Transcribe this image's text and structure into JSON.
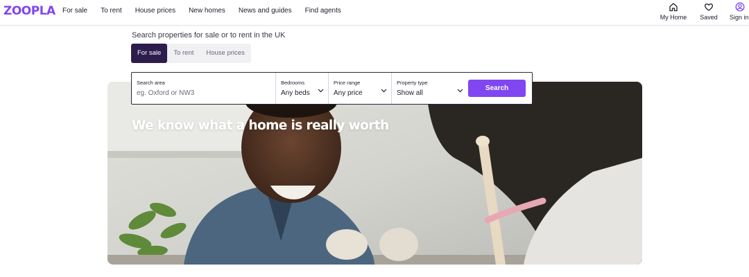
{
  "brand": {
    "logo_text": "ZOOPLA",
    "accent_color": "#8046f1",
    "dark_color": "#2d1d4d"
  },
  "nav": {
    "items": [
      {
        "label": "For sale"
      },
      {
        "label": "To rent"
      },
      {
        "label": "House prices"
      },
      {
        "label": "New homes"
      },
      {
        "label": "News and guides"
      },
      {
        "label": "Find agents"
      }
    ]
  },
  "utility": {
    "my_home": {
      "label": "My Home",
      "icon": "house-icon"
    },
    "saved": {
      "label": "Saved",
      "icon": "heart-icon"
    },
    "sign_in": {
      "label": "Sign in",
      "icon": "user-icon"
    }
  },
  "search": {
    "intro": "Search properties for sale or to rent in the UK",
    "tabs": [
      {
        "label": "For sale",
        "active": true
      },
      {
        "label": "To rent",
        "active": false
      },
      {
        "label": "House prices",
        "active": false
      }
    ],
    "area": {
      "label": "Search area",
      "placeholder": "eg. Oxford or NW3",
      "value": ""
    },
    "bedrooms": {
      "label": "Bedrooms",
      "value": "Any beds"
    },
    "price": {
      "label": "Price range",
      "value": "Any price"
    },
    "type": {
      "label": "Property type",
      "value": "Show all"
    },
    "button_label": "Search"
  },
  "hero": {
    "title": "We know what a home is really worth"
  }
}
